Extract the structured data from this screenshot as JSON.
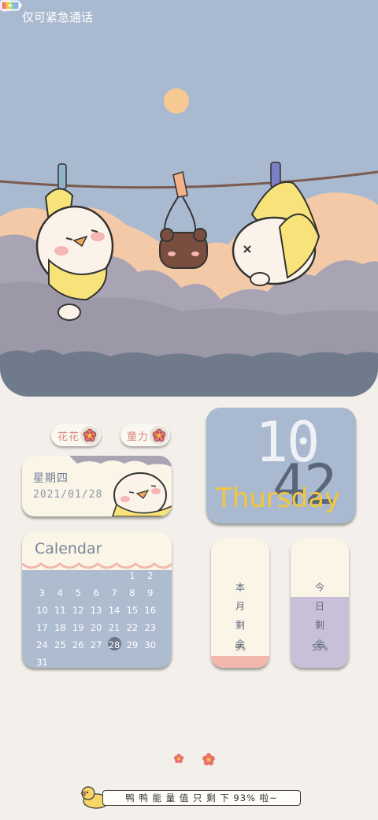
{
  "status_bar": {
    "carrier_text": "仅可紧急通话",
    "icons": [
      "bluetooth-icon",
      "no-sim-icon",
      "wifi-icon",
      "battery-charging-icon"
    ]
  },
  "widgets": {
    "tag_left": "花花",
    "tag_right": "童力",
    "date_card": {
      "weekday": "星期四",
      "date": "2021/01/28"
    },
    "clock": {
      "hour": "10",
      "minute": "42",
      "day_name": "Thursday"
    },
    "calendar": {
      "title": "Calendar",
      "today": 28,
      "weeks": [
        [
          "",
          "",
          "",
          "",
          "",
          "1",
          "2"
        ],
        [
          "3",
          "4",
          "5",
          "6",
          "7",
          "8",
          "9"
        ],
        [
          "10",
          "11",
          "12",
          "13",
          "14",
          "15",
          "16"
        ],
        [
          "17",
          "18",
          "19",
          "20",
          "21",
          "22",
          "23"
        ],
        [
          "24",
          "25",
          "26",
          "27",
          "28",
          "29",
          "30"
        ],
        [
          "31",
          "",
          "",
          "",
          "",
          "",
          ""
        ]
      ]
    },
    "month_progress": {
      "chars": [
        "本",
        "月",
        "剩",
        "余"
      ],
      "percent_text": "9%",
      "fill_fraction": 0.09,
      "color": "#f2b7ad"
    },
    "day_progress": {
      "chars": [
        "今",
        "日",
        "剩",
        "余"
      ],
      "percent_text": "55%",
      "fill_fraction": 0.55,
      "color": "#c8bfd9"
    },
    "energy_text": "鸭 鸭 能 量 值 只 剩 下  93% 啦~"
  },
  "colors": {
    "sky": "#a9b9cf",
    "sun": "#f6c992",
    "clouds_light": "#f3c9a8",
    "clouds_gray": "#a9a4b3",
    "ground": "#6f7b8a",
    "accent_yellow": "#f4c63a"
  }
}
